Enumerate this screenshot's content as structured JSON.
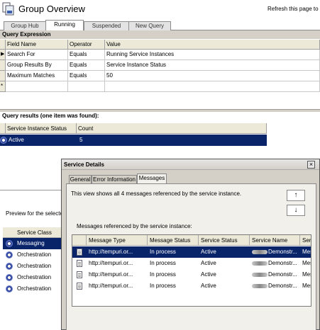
{
  "header": {
    "title": "Group Overview",
    "refresh_text": "Refresh this page to u"
  },
  "tabs": [
    {
      "label": "Group Hub",
      "active": false
    },
    {
      "label": "Running",
      "active": true
    },
    {
      "label": "Suspended",
      "active": false
    },
    {
      "label": "New Query",
      "active": false
    }
  ],
  "query_expression": {
    "section_title": "Query Expression",
    "columns": [
      "Field Name",
      "Operator",
      "Value"
    ],
    "rows": [
      {
        "marker": "▶",
        "field": "Search For",
        "operator": "Equals",
        "value": "Running Service Instances"
      },
      {
        "marker": "",
        "field": "Group Results By",
        "operator": "Equals",
        "value": "Service Instance Status"
      },
      {
        "marker": "",
        "field": "Maximum Matches",
        "operator": "Equals",
        "value": "50"
      },
      {
        "marker": "*",
        "field": "",
        "operator": "",
        "value": ""
      }
    ]
  },
  "query_results": {
    "section_title": "Query results (one item was found):",
    "columns": [
      "Service Instance Status",
      "Count"
    ],
    "rows": [
      {
        "status": "Active",
        "count": "5"
      }
    ]
  },
  "preview": {
    "label": "Preview for the selecte",
    "column": "Service Class",
    "rows": [
      "Messaging",
      "Orchestration",
      "Orchestration",
      "Orchestration",
      "Orchestration"
    ]
  },
  "dialog": {
    "title": "Service Details",
    "close_label": "×",
    "tabs": [
      {
        "label": "General",
        "active": false
      },
      {
        "label": "Error Information",
        "active": false
      },
      {
        "label": "Messages",
        "active": true
      }
    ],
    "summary": "This view shows all 4 messages referenced by the service instance.",
    "up_label": "↑",
    "down_label": "↓",
    "grid_label": "Messages referenced by the service instance:",
    "columns": [
      "Message Type",
      "Message Status",
      "Service Status",
      "Service Name",
      "Servi"
    ],
    "rows": [
      {
        "type": "http://tempuri.or...",
        "status": "In process",
        "service_status": "Active",
        "service_name": "Demonstr...",
        "service_extra": "Messa"
      },
      {
        "type": "http://tempuri.or...",
        "status": "In process",
        "service_status": "Active",
        "service_name": "Demonstr...",
        "service_extra": "Messa"
      },
      {
        "type": "http://tempuri.or...",
        "status": "In process",
        "service_status": "Active",
        "service_name": "Demonstr...",
        "service_extra": "Messa"
      },
      {
        "type": "http://tempuri.or...",
        "status": "In process",
        "service_status": "Active",
        "service_name": "Demonstr...",
        "service_extra": "Messa"
      }
    ]
  },
  "colors": {
    "selection": "#0a246a",
    "chrome": "#d4d0c8"
  }
}
